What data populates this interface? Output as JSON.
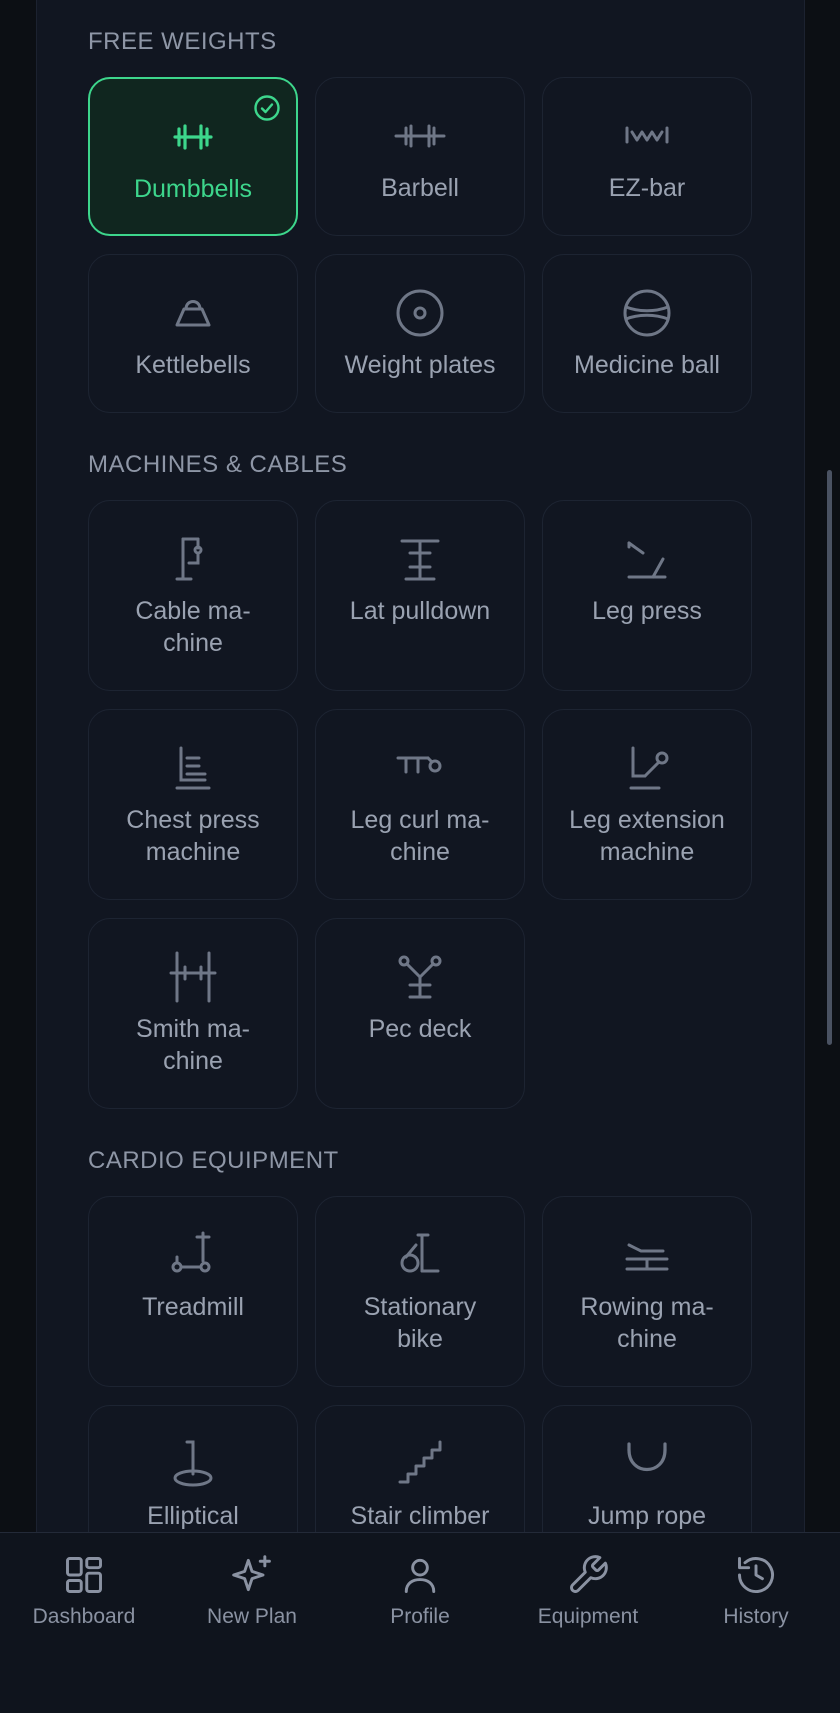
{
  "sections": [
    {
      "title": "FREE WEIGHTS",
      "items": [
        {
          "label": "Dumbbells",
          "icon": "dumbbell-icon",
          "selected": true
        },
        {
          "label": "Barbell",
          "icon": "barbell-icon",
          "selected": false
        },
        {
          "label": "EZ-bar",
          "icon": "ez-bar-icon",
          "selected": false
        },
        {
          "label": "Kettlebells",
          "icon": "kettlebell-icon",
          "selected": false
        },
        {
          "label": "Weight plates",
          "icon": "weight-plate-icon",
          "selected": false
        },
        {
          "label": "Medicine ball",
          "icon": "medicine-ball-icon",
          "selected": false
        }
      ]
    },
    {
      "title": "MACHINES & CABLES",
      "items": [
        {
          "label": "Cable ma-\nchine",
          "icon": "cable-machine-icon",
          "selected": false
        },
        {
          "label": "Lat pulldown",
          "icon": "lat-pulldown-icon",
          "selected": false
        },
        {
          "label": "Leg press",
          "icon": "leg-press-icon",
          "selected": false
        },
        {
          "label": "Chest press\nmachine",
          "icon": "chest-press-icon",
          "selected": false
        },
        {
          "label": "Leg curl ma-\nchine",
          "icon": "leg-curl-icon",
          "selected": false
        },
        {
          "label": "Leg extension\nmachine",
          "icon": "leg-extension-icon",
          "selected": false
        },
        {
          "label": "Smith ma-\nchine",
          "icon": "smith-machine-icon",
          "selected": false
        },
        {
          "label": "Pec deck",
          "icon": "pec-deck-icon",
          "selected": false
        }
      ]
    },
    {
      "title": "CARDIO EQUIPMENT",
      "items": [
        {
          "label": "Treadmill",
          "icon": "treadmill-icon",
          "selected": false
        },
        {
          "label": "Stationary\nbike",
          "icon": "stationary-bike-icon",
          "selected": false
        },
        {
          "label": "Rowing ma-\nchine",
          "icon": "rowing-machine-icon",
          "selected": false
        },
        {
          "label": "Elliptical",
          "icon": "elliptical-icon",
          "selected": false
        },
        {
          "label": "Stair climber",
          "icon": "stair-climber-icon",
          "selected": false
        },
        {
          "label": "Jump rope",
          "icon": "jump-rope-icon",
          "selected": false
        }
      ]
    }
  ],
  "nav": [
    {
      "label": "Dashboard",
      "icon": "dashboard-icon"
    },
    {
      "label": "New Plan",
      "icon": "sparkle-icon"
    },
    {
      "label": "Profile",
      "icon": "user-icon"
    },
    {
      "label": "Equipment",
      "icon": "wrench-icon"
    },
    {
      "label": "History",
      "icon": "history-icon"
    }
  ],
  "colors": {
    "accent": "#3dd68c",
    "background": "#0c0f14",
    "panel": "#111621",
    "card_border": "#1d2432",
    "muted_text": "#9aa2b1"
  }
}
